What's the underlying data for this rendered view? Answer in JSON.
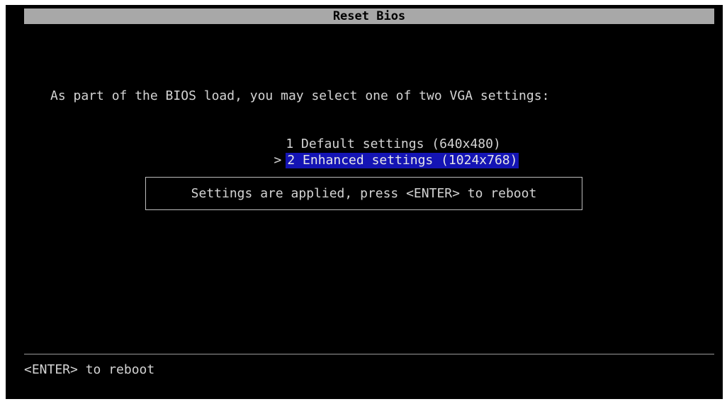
{
  "window": {
    "title": "Reset Bios"
  },
  "main": {
    "prompt": "As part of the BIOS load, you may select one of two VGA settings:",
    "options": [
      {
        "cursor": "",
        "label": "1 Default settings (640x480)",
        "selected": false
      },
      {
        "cursor": ">",
        "label": "2 Enhanced settings (1024x768)",
        "selected": true
      }
    ],
    "message": "Settings are applied, press <ENTER> to reboot"
  },
  "footer": {
    "hint": "<ENTER> to reboot"
  },
  "colors": {
    "background": "#000000",
    "text": "#d4d4d4",
    "title_bar": "#a8a8a8",
    "selection": "#1414b4"
  }
}
